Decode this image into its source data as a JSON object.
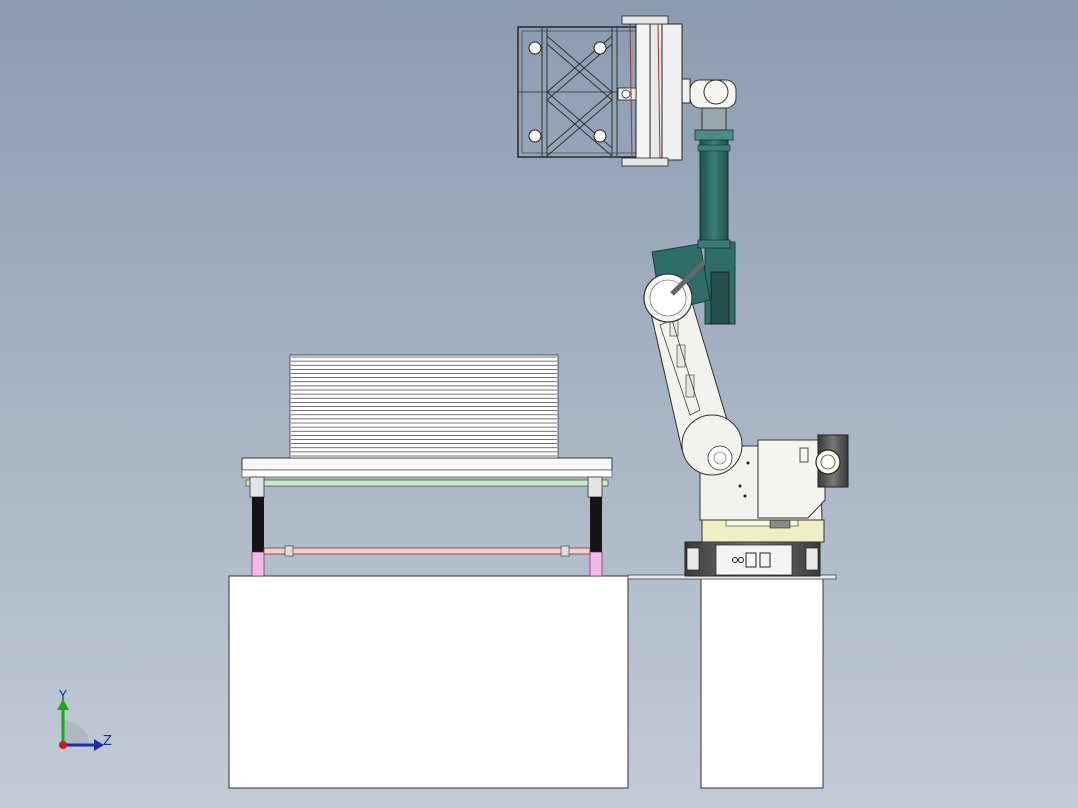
{
  "viewport": {
    "background_top": "#8a9bb1",
    "background_bottom": "#c2cbd6"
  },
  "triad": {
    "y_label": "Y",
    "z_label": "Z",
    "y_color": "#1aa81a",
    "z_color": "#1d2f9b",
    "origin_color": "#d11818"
  },
  "scene": {
    "parts": [
      "table-base-left",
      "table-base-right",
      "stacking-frame",
      "sheet-stack",
      "robot-base",
      "robot-lower-arm",
      "robot-upper-arm",
      "robot-wrist",
      "gripper-frame"
    ],
    "sheet_count": 24,
    "colors": {
      "robot_body": "#f2f2ee",
      "robot_arm_accent": "#2f6d69",
      "robot_turntable": "#efefc6",
      "frame_green_rod": "#cfe6cf",
      "frame_red_rod": "#f2cfcf",
      "frame_pink": "#f0b9e8",
      "outline": "#2a2a2a"
    }
  }
}
